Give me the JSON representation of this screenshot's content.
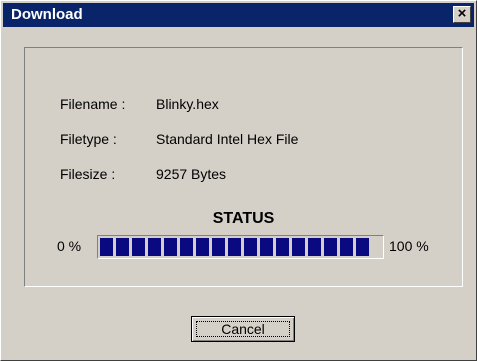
{
  "window": {
    "title": "Download",
    "close_glyph": "×"
  },
  "info": {
    "filename_label": "Filename :",
    "filename_value": "Blinky.hex",
    "filetype_label": "Filetype :",
    "filetype_value": "Standard Intel Hex File",
    "filesize_label": "Filesize :",
    "filesize_value": "9257 Bytes"
  },
  "status": {
    "heading": "STATUS",
    "min_label": "0 %",
    "max_label": "100 %",
    "progress_fraction": 0.95,
    "fill_color": "#0a0a80"
  },
  "buttons": {
    "cancel_label": "Cancel"
  }
}
